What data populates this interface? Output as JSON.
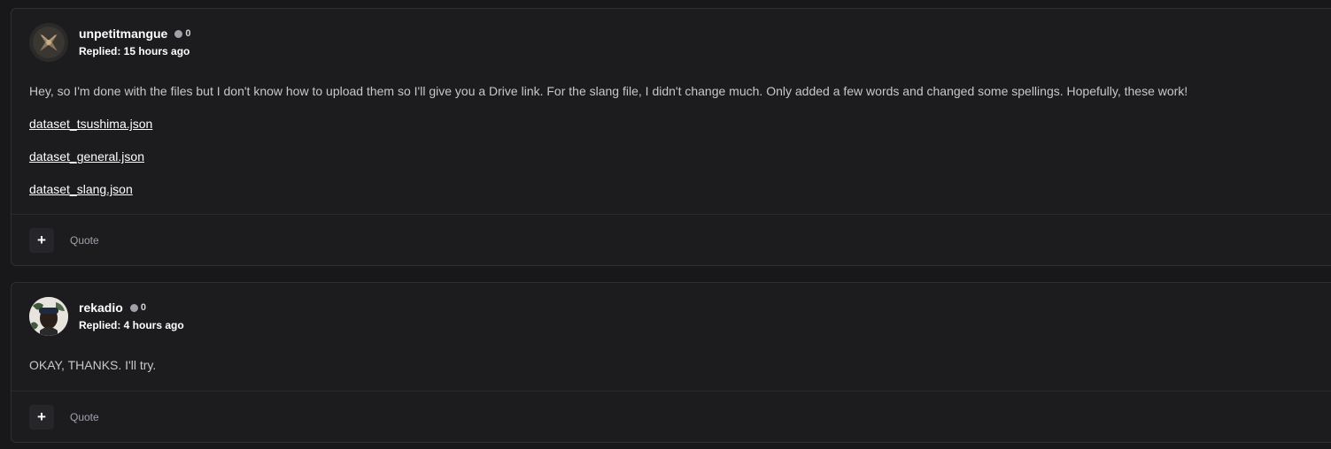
{
  "posts": [
    {
      "author": "unpetitmangue",
      "reputation": "0",
      "replied": "Replied: 15 hours ago",
      "body": "Hey, so I'm done with the files but I don't know how to upload them so I'll give you a Drive link. For the slang file, I didn't change much. Only added a few words and changed some spellings. Hopefully, these work!",
      "links": [
        "dataset_tsushima.json",
        "dataset_general.json",
        "dataset_slang.json"
      ],
      "actions": {
        "plus_icon": "plus-icon",
        "quote_label": "Quote"
      }
    },
    {
      "author": "rekadio",
      "reputation": "0",
      "replied": "Replied: 4 hours ago",
      "body": "OKAY, THANKS. I'll try.",
      "actions": {
        "plus_icon": "plus-icon",
        "quote_label": "Quote"
      }
    }
  ],
  "colors": {
    "background": "#18181b",
    "card": "#1c1c1f",
    "border": "#2e2e33",
    "text": "#c8c8cc",
    "username": "#ffffff"
  }
}
